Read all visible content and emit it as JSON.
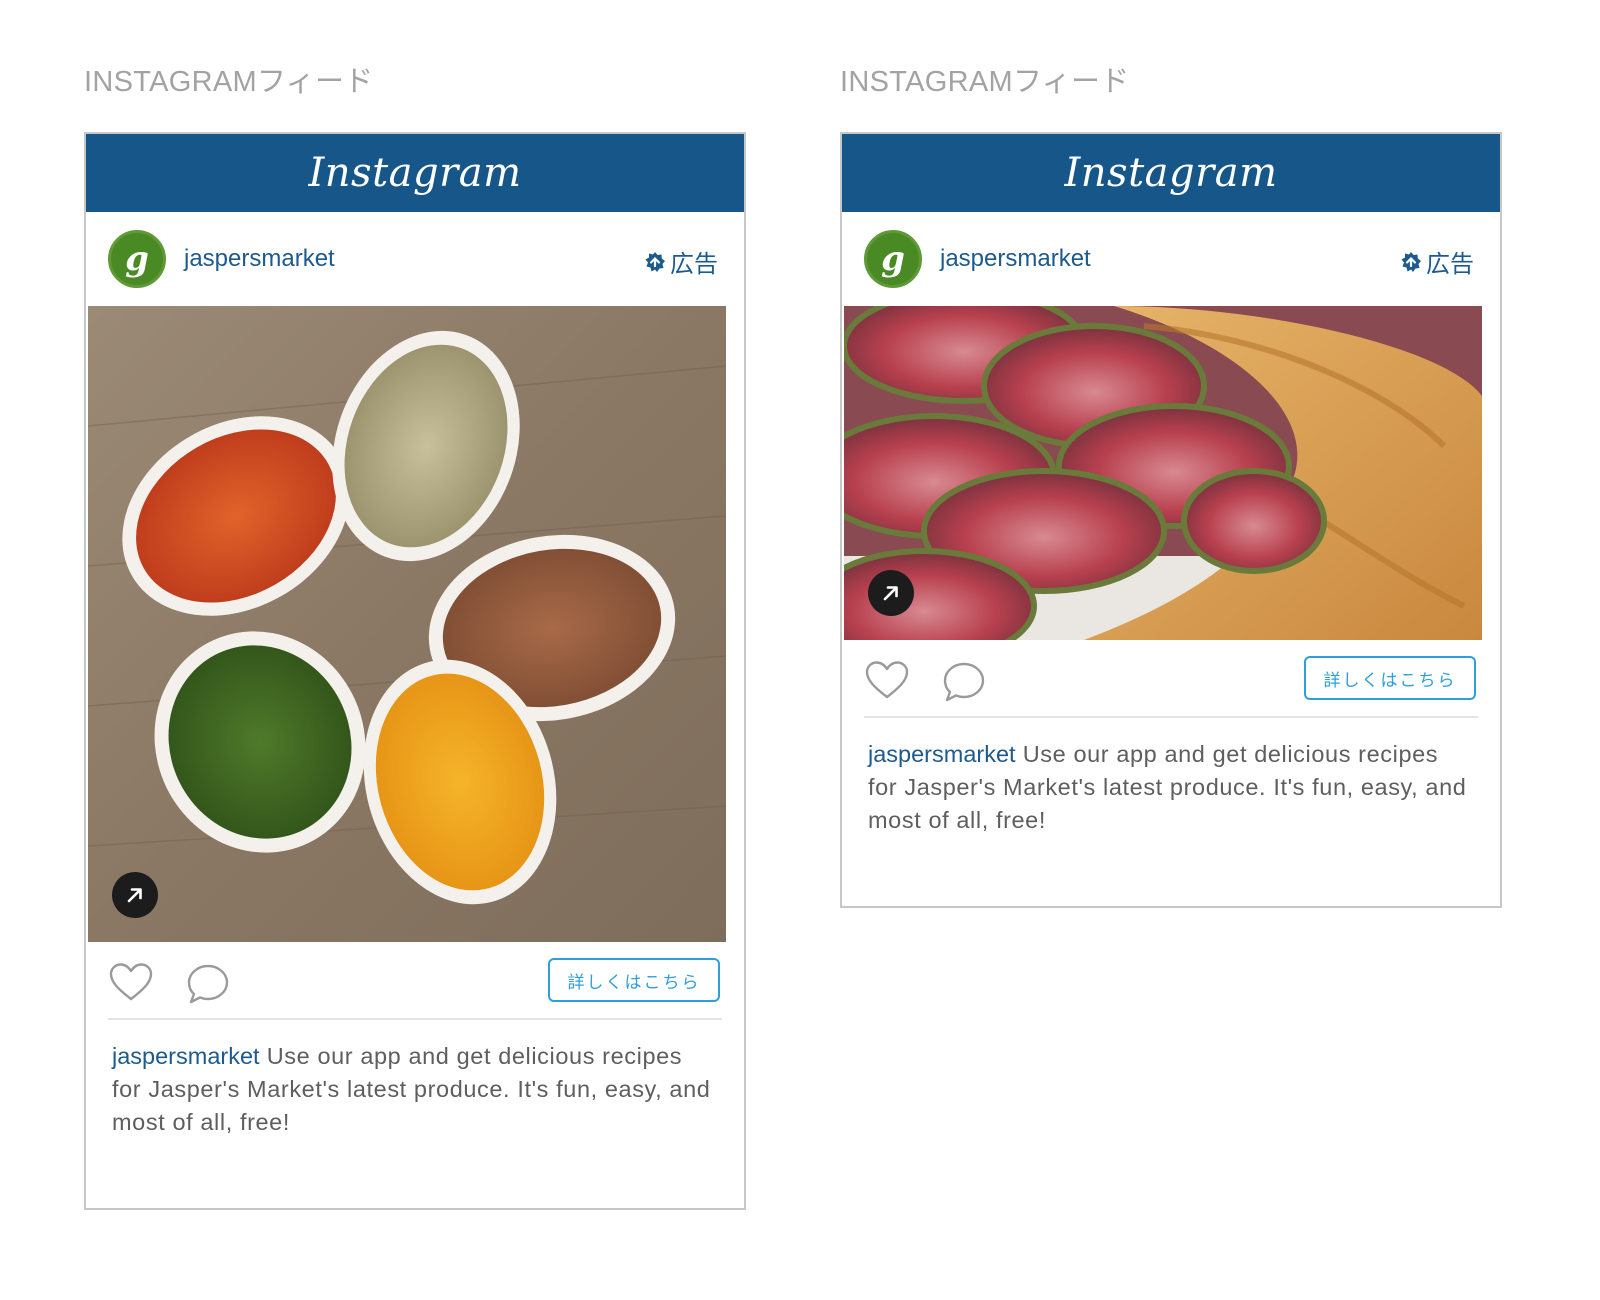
{
  "feeds": [
    {
      "section_label": "INSTAGRAMフィード",
      "brand_title": "Instagram",
      "account": {
        "avatar_letter": "g",
        "username": "jaspersmarket"
      },
      "ad_label": "広告",
      "media": {
        "description_icon": "arrow-up-right-icon"
      },
      "actions": {
        "cta_label": "詳しくはこちら"
      },
      "caption": {
        "username": "jaspersmarket",
        "text": "Use our app and get delicious recipes for Jasper's Market's latest produce. It's fun, easy, and most of all, free!"
      }
    },
    {
      "section_label": "INSTAGRAMフィード",
      "brand_title": "Instagram",
      "account": {
        "avatar_letter": "g",
        "username": "jaspersmarket"
      },
      "ad_label": "広告",
      "media": {
        "description_icon": "arrow-up-right-icon"
      },
      "actions": {
        "cta_label": "詳しくはこちら"
      },
      "caption": {
        "username": "jaspersmarket",
        "text": "Use our app and get delicious recipes for Jasper's Market's latest produce. It's fun, easy, and most of all, free!"
      }
    }
  ],
  "colors": {
    "header_bg": "#165689",
    "link_blue": "#1d5a8d",
    "cta_blue": "#2e9fd9",
    "avatar_green": "#4a8a24",
    "label_gray": "#a3a3a3"
  }
}
